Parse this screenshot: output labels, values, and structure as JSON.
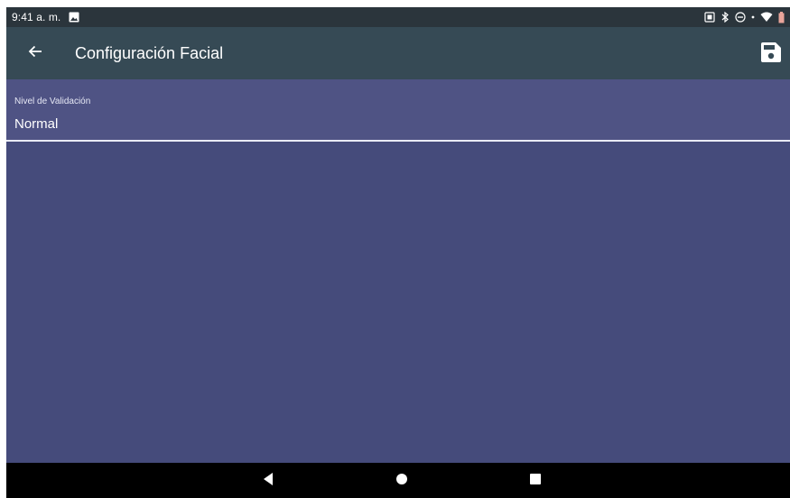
{
  "status_bar": {
    "time": "9:41 a. m.",
    "left_icons": [
      "image-icon"
    ],
    "right_icons": [
      "vibrate-icon",
      "bluetooth-icon",
      "do-not-disturb-icon",
      "dot-icon",
      "wifi-icon",
      "battery-icon"
    ]
  },
  "app_bar": {
    "title": "Configuración Facial",
    "back_icon": "arrow-left-icon",
    "save_icon": "floppy-disk-icon"
  },
  "field": {
    "label": "Nivel de Validación",
    "value": "Normal"
  },
  "nav_bar": {
    "buttons": [
      "back-triangle",
      "home-circle",
      "recents-square"
    ]
  },
  "colors": {
    "background": "#454b7b",
    "status_bar": "#2b353c",
    "app_bar": "#364a55",
    "field_background": "#4f5384",
    "nav_bar": "#000000"
  }
}
